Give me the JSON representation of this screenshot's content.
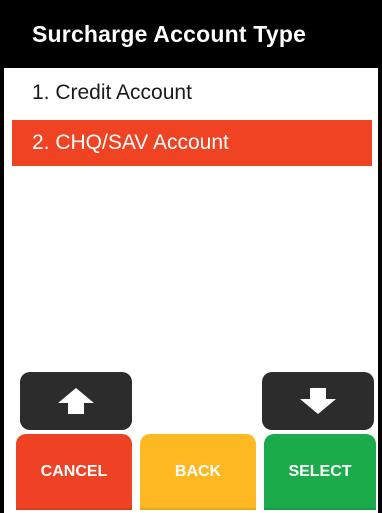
{
  "header": {
    "title": "Surcharge Account Type"
  },
  "menu": {
    "items": [
      {
        "label": "1. Credit Account",
        "selected": false
      },
      {
        "label": "2. CHQ/SAV Account",
        "selected": true
      }
    ]
  },
  "nav": {
    "up_icon": "arrow-up-icon",
    "down_icon": "arrow-down-icon"
  },
  "actions": {
    "cancel_label": "CANCEL",
    "back_label": "BACK",
    "select_label": "SELECT"
  },
  "colors": {
    "title_bar": "#000000",
    "selected_row": "#ef4323",
    "arrow_button": "#2c2c2c",
    "cancel": "#ef4123",
    "back": "#fdb822",
    "select": "#1cab4b"
  }
}
